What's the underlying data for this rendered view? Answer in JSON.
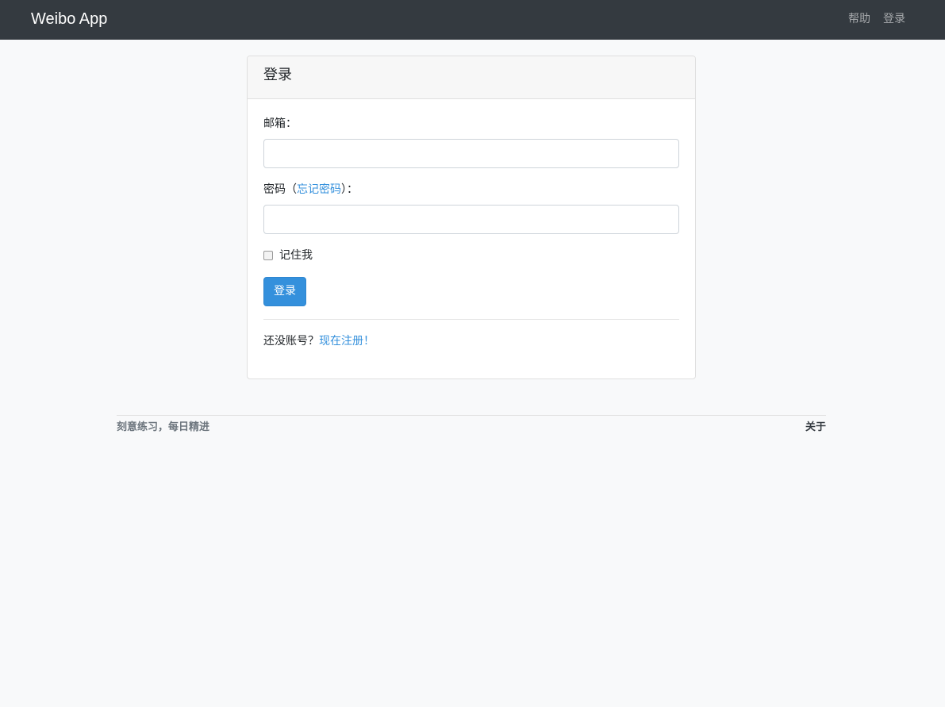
{
  "navbar": {
    "brand": "Weibo App",
    "links": {
      "help": "帮助",
      "login": "登录"
    }
  },
  "login_card": {
    "title": "登录",
    "email_label": "邮箱：",
    "email_value": "",
    "password_label_prefix": "密码（",
    "forgot_password_link": "忘记密码",
    "password_label_suffix": "）：",
    "password_value": "",
    "remember_me_label": "记住我",
    "remember_me_checked": false,
    "submit_label": "登录",
    "no_account_text": "还没账号？",
    "register_link": "现在注册！"
  },
  "footer": {
    "slogan": "刻意练习，每日精进",
    "about_link": "关于"
  },
  "colors": {
    "navbar_bg": "#343a40",
    "primary": "#3490dc",
    "page_bg": "#f8f9fa"
  }
}
